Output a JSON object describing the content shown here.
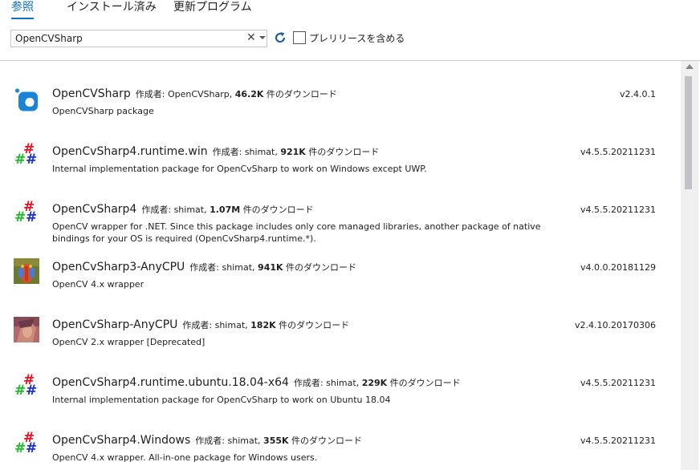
{
  "tabs": [
    "参照",
    "インストール済み",
    "更新プログラム"
  ],
  "search": {
    "value": "OpenCVSharp",
    "placeholder": ""
  },
  "prerelease_label": "プレリリースを含める",
  "colors": {
    "accent": "#0e70c0",
    "hash_red": "#e81123",
    "hash_green": "#1fbf28",
    "hash_blue": "#1a2fd6"
  },
  "packages": [
    {
      "icon": "nuget-blue-icon",
      "name": "OpenCVSharp",
      "author_label": "作成者:",
      "author": "OpenCVSharp,",
      "downloads": "46.2K",
      "downloads_suffix": "件のダウンロード",
      "description": "OpenCVSharp package",
      "version": "v2.4.0.1"
    },
    {
      "icon": "hash-icon",
      "name": "OpenCvSharp4.runtime.win",
      "author_label": "作成者:",
      "author": "shimat,",
      "downloads": "921K",
      "downloads_suffix": "件のダウンロード",
      "description": "Internal implementation package for OpenCvSharp to work on Windows except UWP.",
      "version": "v4.5.5.20211231"
    },
    {
      "icon": "hash-icon",
      "name": "OpenCvSharp4",
      "author_label": "作成者:",
      "author": "shimat,",
      "downloads": "1.07M",
      "downloads_suffix": "件のダウンロード",
      "description": "OpenCV wrapper for .NET. Since this package includes only core managed libraries, another package of native bindings for your OS is required (OpenCvSharp4.runtime.*).",
      "version": "v4.5.5.20211231"
    },
    {
      "icon": "mandrill-icon",
      "name": "OpenCvSharp3-AnyCPU",
      "author_label": "作成者:",
      "author": "shimat,",
      "downloads": "941K",
      "downloads_suffix": "件のダウンロード",
      "description": "OpenCV 4.x wrapper",
      "version": "v4.0.0.20181129"
    },
    {
      "icon": "lenna-icon",
      "name": "OpenCvSharp-AnyCPU",
      "author_label": "作成者:",
      "author": "shimat,",
      "downloads": "182K",
      "downloads_suffix": "件のダウンロード",
      "description": "OpenCV 2.x wrapper [Deprecated]",
      "version": "v2.4.10.20170306"
    },
    {
      "icon": "hash-icon",
      "name": "OpenCvSharp4.runtime.ubuntu.18.04-x64",
      "author_label": "作成者:",
      "author": "shimat,",
      "downloads": "229K",
      "downloads_suffix": "件のダウンロード",
      "description": "Internal implementation package for OpenCvSharp to work on Ubuntu 18.04",
      "version": "v4.5.5.20211231"
    },
    {
      "icon": "hash-icon",
      "name": "OpenCvSharp4.Windows",
      "author_label": "作成者:",
      "author": "shimat,",
      "downloads": "355K",
      "downloads_suffix": "件のダウンロード",
      "description": "OpenCV 4.x wrapper. All-in-one package for Windows users.",
      "version": "v4.5.5.20211231"
    }
  ]
}
